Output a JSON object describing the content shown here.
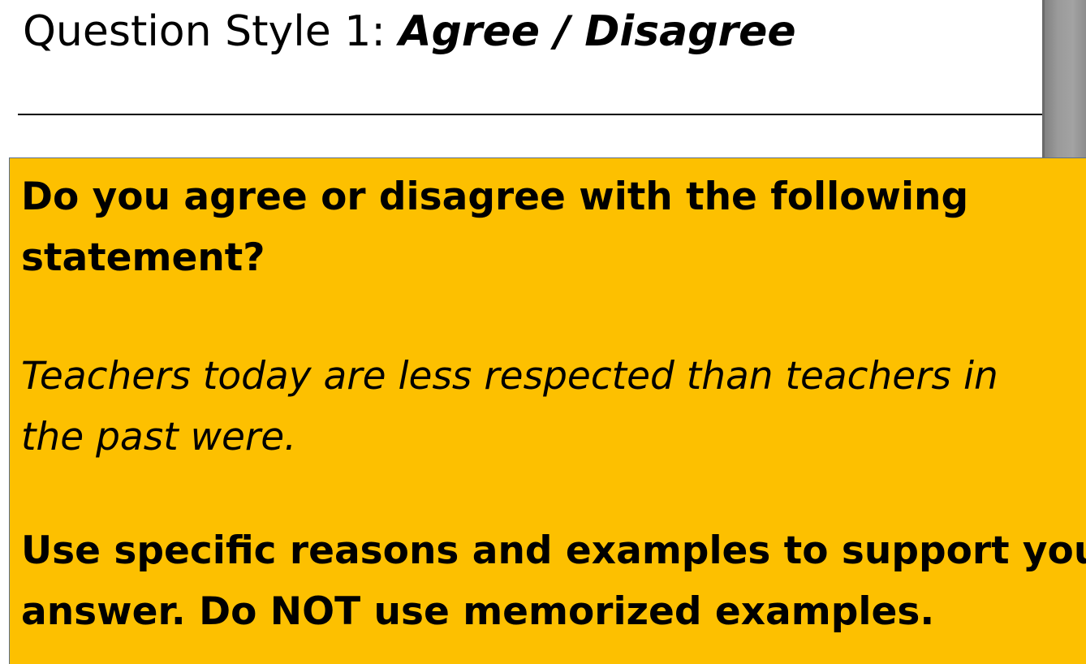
{
  "slide": {
    "title_prefix": "Question Style 1: ",
    "title_emphasis": "Agree / Disagree",
    "prompt_line1": "Do you agree or disagree with the following",
    "prompt_line2": "statement?",
    "statement_line1": "Teachers today are less respected than teachers in",
    "statement_line2": "the past were.",
    "instruction_line1": "Use specific reasons and examples to support your",
    "instruction_line2": "answer. Do NOT use memorized examples."
  },
  "colors": {
    "box_fill": "#fdc000",
    "box_border": "#5a6e8c",
    "text": "#000000",
    "background": "#ffffff"
  }
}
